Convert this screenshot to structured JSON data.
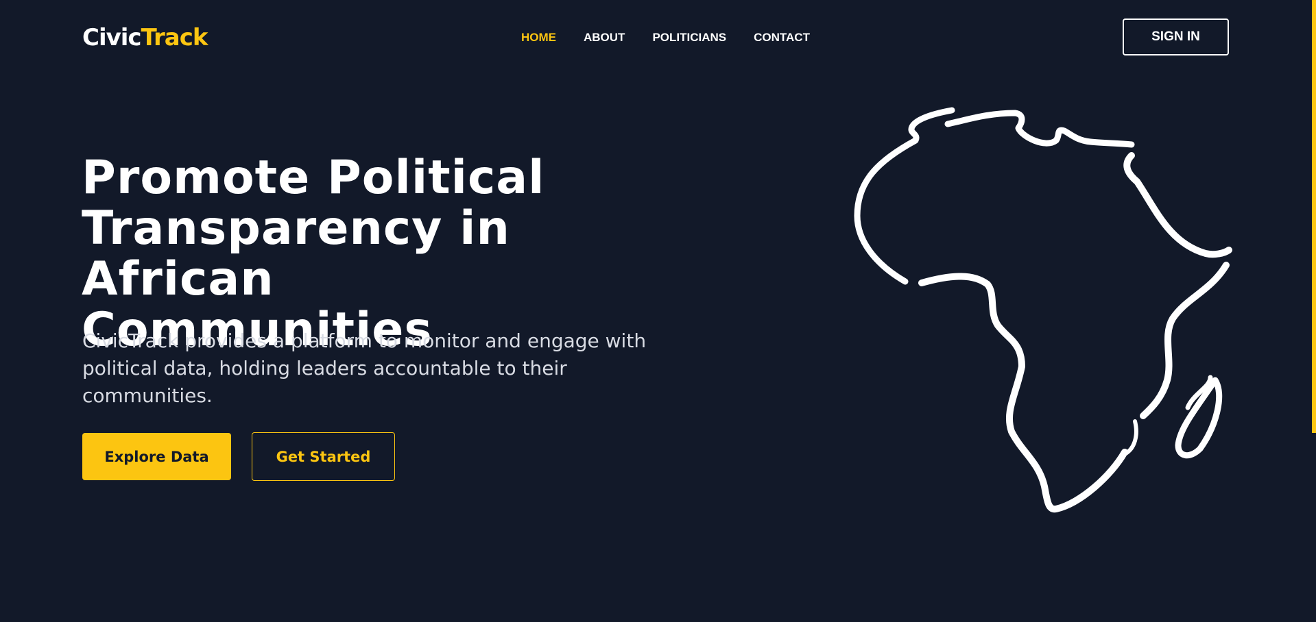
{
  "logo": {
    "part1": "Civic",
    "part2": "Track"
  },
  "nav": {
    "items": [
      {
        "label": "HOME"
      },
      {
        "label": "ABOUT"
      },
      {
        "label": "POLITICIANS"
      },
      {
        "label": "CONTACT"
      }
    ],
    "active_index": 0
  },
  "header": {
    "signin_label": "SIGN IN"
  },
  "hero": {
    "title_line1": "Promote Political",
    "title_line2": "Transparency in African",
    "title_line3": "Communities",
    "subtitle": "CivicTrack provides a platform to monitor and engage with political data, holding leaders accountable to their communities.",
    "primary_cta": "Explore Data",
    "secondary_cta": "Get Started"
  },
  "illustration": {
    "icon": "africa-map-outline-icon"
  },
  "colors": {
    "background": "#121929",
    "accent": "#fcc511",
    "text": "#ffffff",
    "muted_text": "#d8dbe3"
  }
}
